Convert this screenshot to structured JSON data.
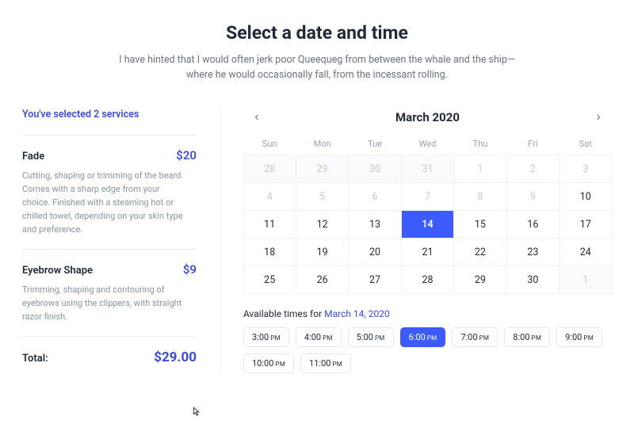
{
  "header": {
    "title": "Select a date and time",
    "subtitle": "I have hinted that I would often jerk poor Queequeg from between the whale and the ship—where he would occasionally fall, from the incessant rolling."
  },
  "summary": {
    "heading": "You've selected 2 services",
    "services": [
      {
        "name": "Fade",
        "price": "$20",
        "desc": "Cutting, shaping or trimming of the beard. Comes with a sharp edge from your choice. Finished with a steaming hot or chilled towel, depending on your skin type and preference."
      },
      {
        "name": "Eyebrow Shape",
        "price": "$9",
        "desc": "Trimming, shaping and contouring of eyebrows using the clippers, with straight razor finish."
      }
    ],
    "total_label": "Total:",
    "total_price": "$29.00"
  },
  "calendar": {
    "month_label": "March 2020",
    "dow": [
      "Sun",
      "Mon",
      "Tue",
      "Wed",
      "Thu",
      "Fri",
      "Sat"
    ],
    "weeks": [
      [
        {
          "n": "28",
          "o": true
        },
        {
          "n": "29",
          "o": true
        },
        {
          "n": "30",
          "o": true
        },
        {
          "n": "31",
          "o": true
        },
        {
          "n": "1",
          "d": true
        },
        {
          "n": "2",
          "d": true
        },
        {
          "n": "3",
          "d": true
        }
      ],
      [
        {
          "n": "4",
          "d": true
        },
        {
          "n": "5",
          "d": true
        },
        {
          "n": "6",
          "d": true
        },
        {
          "n": "7",
          "d": true
        },
        {
          "n": "8",
          "d": true
        },
        {
          "n": "9",
          "d": true
        },
        {
          "n": "10"
        }
      ],
      [
        {
          "n": "11"
        },
        {
          "n": "12"
        },
        {
          "n": "13"
        },
        {
          "n": "14",
          "s": true
        },
        {
          "n": "15"
        },
        {
          "n": "16"
        },
        {
          "n": "17"
        }
      ],
      [
        {
          "n": "18"
        },
        {
          "n": "19"
        },
        {
          "n": "20"
        },
        {
          "n": "21"
        },
        {
          "n": "22"
        },
        {
          "n": "23"
        },
        {
          "n": "24"
        }
      ],
      [
        {
          "n": "25"
        },
        {
          "n": "26"
        },
        {
          "n": "27"
        },
        {
          "n": "28"
        },
        {
          "n": "29"
        },
        {
          "n": "30"
        },
        {
          "n": "1",
          "o": true
        }
      ]
    ]
  },
  "times": {
    "label_prefix": "Available times for ",
    "label_date": "March 14, 2020",
    "slots": [
      {
        "t": "3:00",
        "p": "PM"
      },
      {
        "t": "4:00",
        "p": "PM"
      },
      {
        "t": "5:00",
        "p": "PM"
      },
      {
        "t": "6:00",
        "p": "PM",
        "s": true
      },
      {
        "t": "7:00",
        "p": "PM"
      },
      {
        "t": "8:00",
        "p": "PM"
      },
      {
        "t": "9:00",
        "p": "PM"
      },
      {
        "t": "10:00",
        "p": "PM"
      },
      {
        "t": "11:00",
        "p": "PM"
      }
    ]
  }
}
